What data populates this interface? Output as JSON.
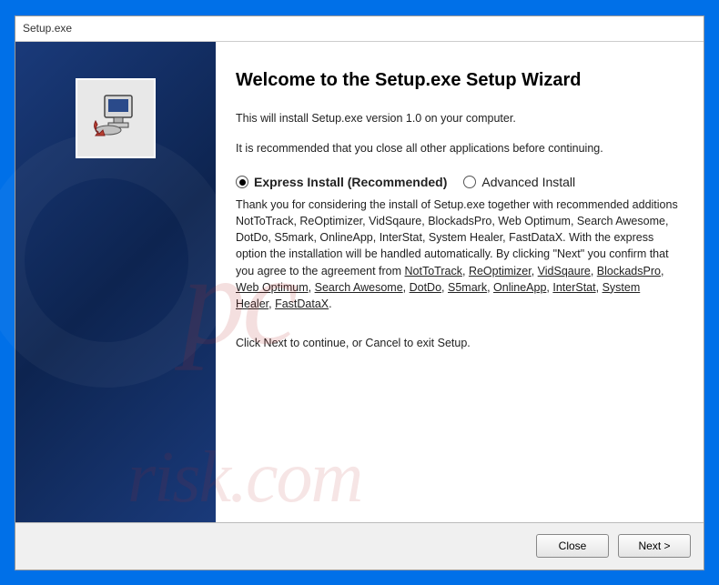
{
  "window": {
    "title": "Setup.exe"
  },
  "main": {
    "heading": "Welcome to the Setup.exe Setup Wizard",
    "intro": "This will install Setup.exe version 1.0 on your computer.",
    "recommend": "It is recommended that you close all other applications before continuing.",
    "options": {
      "express_label": "Express Install (Recommended)",
      "advanced_label": "Advanced Install",
      "express_selected": true
    },
    "description_prefix": "Thank you for considering the install of Setup.exe together with recommended additions NotToTrack, ReOptimizer, VidSqaure, BlockadsPro, Web Optimum, Search Awesome, DotDo, S5mark, OnlineApp, InterStat, System Healer, FastDataX. With the express option the installation will be handled automatically. By clicking \"Next\" you confirm that you agree to the agreement from ",
    "links": [
      "NotToTrack",
      "ReOptimizer",
      "VidSqaure",
      "BlockadsPro",
      "Web Optimum",
      "Search Awesome",
      "DotDo",
      "S5mark",
      "OnlineApp",
      "InterStat",
      "System Healer",
      "FastDataX"
    ],
    "next_instruction": "Click Next to continue, or Cancel to exit Setup."
  },
  "buttons": {
    "close": "Close",
    "next": "Next >"
  },
  "watermark": {
    "main": "pc",
    "sub": "risk.com"
  }
}
